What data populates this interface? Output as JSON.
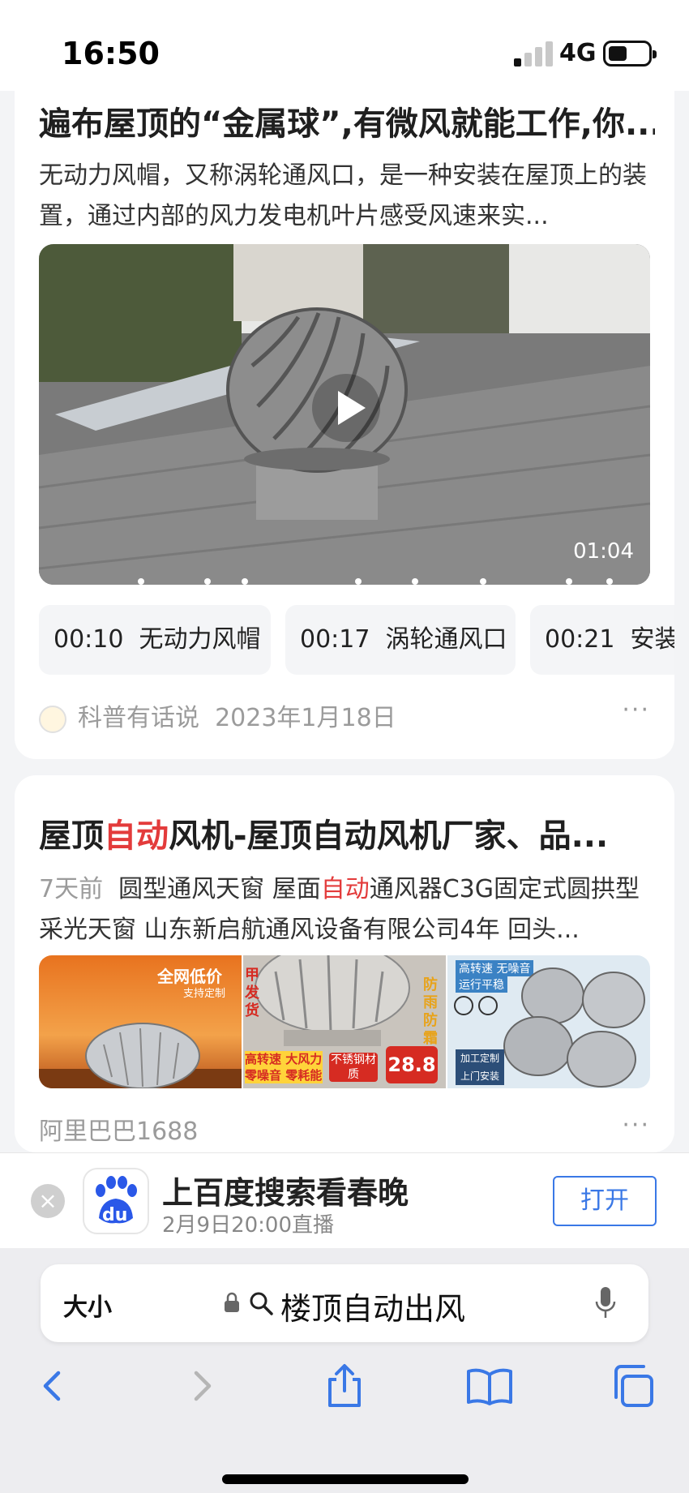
{
  "status_bar": {
    "time": "16:50",
    "network": "4G"
  },
  "result1": {
    "title": "遍布屋顶的“金属球”,有微风就能工作,你...",
    "description": "无动力风帽，又称涡轮通风口，是一种安装在屋顶上的装置，通过内部的风力发电机叶片感受风速来实...",
    "video_duration": "01:04",
    "chapters": [
      {
        "time": "00:10",
        "label": "无动力风帽"
      },
      {
        "time": "00:17",
        "label": "涡轮通风口"
      },
      {
        "time": "00:21",
        "label": "安装"
      }
    ],
    "source": "科普有话说",
    "date": "2023年1月18日",
    "more": "···"
  },
  "result2": {
    "title_pre": "屋顶",
    "title_hl": "自动",
    "title_post": "风机-屋顶自动风机厂家、品...",
    "desc_age": "7天前",
    "desc_a": "圆型通风天窗 屋面",
    "desc_hl": "自动",
    "desc_b": "通风器C3G固定式圆拱型采光天窗 山东新启航通风设备有限公司4年 回头...",
    "thumb1_text1": "全网低价",
    "thumb1_text2": "支持定制",
    "thumb2_text1": "甲发货",
    "thumb2_text2": "防雨防霜",
    "thumb2_text3": "高转速 大风力",
    "thumb2_text4": "零噪音 零耗能",
    "thumb2_text5": "不锈钢材质",
    "thumb2_text6": "28.8",
    "thumb3_text1": "高转速 无噪音",
    "thumb3_text2": "运行平稳",
    "thumb3_text3": "加工定制",
    "thumb3_text4": "上门安装",
    "source": "阿里巴巴1688",
    "more": "···"
  },
  "banner": {
    "close": "×",
    "title": "上百度搜索看春晚",
    "subtitle": "2月9日20:00直播",
    "open_label": "打开",
    "app_icon_text": "du"
  },
  "toolbar": {
    "text_size_label": "大小",
    "url": "楼顶自动出风"
  },
  "colors": {
    "highlight": "#e33b3b",
    "link_blue": "#3a78e6"
  }
}
